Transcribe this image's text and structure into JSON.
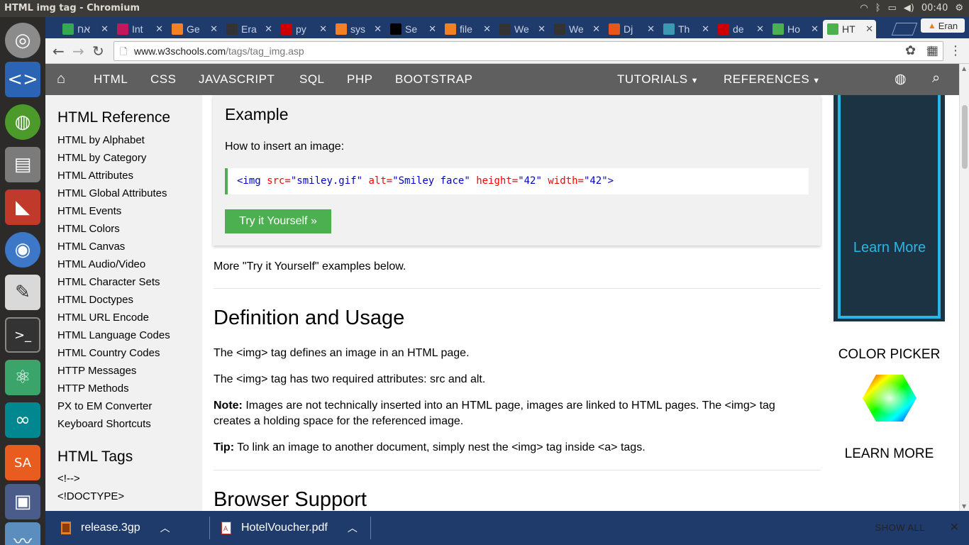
{
  "window": {
    "title": "HTML img tag - Chromium",
    "clock": "00:40"
  },
  "launcher": [
    "ubuntu-icon",
    "code-editor-icon",
    "network-globe-icon",
    "file-manager-icon",
    "red-app-icon",
    "chromium-icon",
    "text-editor-icon",
    "terminal-icon",
    "atom-icon",
    "arduino-icon",
    "sa-app-icon",
    "remote-desktop-icon",
    "system-monitor-icon"
  ],
  "tabs": [
    {
      "label": "אח",
      "icon": "google-drive-icon",
      "color": "#34a853"
    },
    {
      "label": "Int",
      "icon": "intellij-icon",
      "color": "#c2185b"
    },
    {
      "label": "Ge",
      "icon": "stackoverflow-icon",
      "color": "#f48024"
    },
    {
      "label": "Era",
      "icon": "github-icon",
      "color": "#333333"
    },
    {
      "label": "py",
      "icon": "pypi-icon",
      "color": "#cc0000"
    },
    {
      "label": "sys",
      "icon": "stackoverflow-icon",
      "color": "#f48024"
    },
    {
      "label": "Se",
      "icon": "ex-icon",
      "color": "#000000"
    },
    {
      "label": "file",
      "icon": "stackoverflow-icon",
      "color": "#f48024"
    },
    {
      "label": "We",
      "icon": "github-icon",
      "color": "#333333"
    },
    {
      "label": "We",
      "icon": "github-icon",
      "color": "#333333"
    },
    {
      "label": "Dj",
      "icon": "django-icon",
      "color": "#e8561a"
    },
    {
      "label": "Th",
      "icon": "p-icon",
      "color": "#3b9ab2"
    },
    {
      "label": "de",
      "icon": "pypi-icon",
      "color": "#cc0000"
    },
    {
      "label": "Ho",
      "icon": "z2-icon",
      "color": "#4caf50"
    },
    {
      "label": "HT",
      "icon": "w3schools-icon",
      "color": "#4caf50"
    }
  ],
  "profile": {
    "name": "Eran"
  },
  "omnibox": {
    "host": "www.w3schools.com",
    "path": "/tags/tag_img.asp"
  },
  "w3nav": {
    "links": [
      "HTML",
      "CSS",
      "JAVASCRIPT",
      "SQL",
      "PHP",
      "BOOTSTRAP"
    ],
    "tutorials": "TUTORIALS",
    "references": "REFERENCES"
  },
  "sidebar": {
    "heading": "HTML Reference",
    "links": [
      "HTML by Alphabet",
      "HTML by Category",
      "HTML Attributes",
      "HTML Global Attributes",
      "HTML Events",
      "HTML Colors",
      "HTML Canvas",
      "HTML Audio/Video",
      "HTML Character Sets",
      "HTML Doctypes",
      "HTML URL Encode",
      "HTML Language Codes",
      "HTML Country Codes",
      "HTTP Messages",
      "HTTP Methods",
      "PX to EM Converter",
      "Keyboard Shortcuts"
    ],
    "tags_heading": "HTML Tags",
    "tags": [
      "<!-->",
      "<!DOCTYPE>"
    ]
  },
  "example": {
    "heading": "Example",
    "intro": "How to insert an image:",
    "code": {
      "tag_open": "<img",
      "src_attr": " src=",
      "src_val": "\"smiley.gif\"",
      "alt_attr": " alt=",
      "alt_val": "\"Smiley face\"",
      "height_attr": " height=",
      "height_val": "\"42\"",
      "width_attr": " width=",
      "width_val": "\"42\"",
      "tag_close": ">"
    },
    "try_button": "Try it Yourself »"
  },
  "content": {
    "more_examples": "More \"Try it Yourself\" examples below.",
    "definition_heading": "Definition and Usage",
    "p1": "The <img> tag defines an image in an HTML page.",
    "p2": "The <img> tag has two required attributes: src and alt.",
    "note_label": "Note:",
    "note_line1": " Images are not technically inserted into an HTML page, images are linked to HTML pages. The <img> tag",
    "note_line2": "creates a holding space for the referenced image.",
    "tip_label": "Tip:",
    "tip_text": " To link an image to another document, simply nest the <img> tag inside <a> tags.",
    "browser_heading": "Browser Support"
  },
  "right": {
    "ad_learn_more": "Learn More",
    "color_picker": "COLOR PICKER",
    "learn_more": "LEARN MORE"
  },
  "downloads": {
    "items": [
      {
        "name": "release.3gp",
        "icon": "video-file-icon"
      },
      {
        "name": "HotelVoucher.pdf",
        "icon": "pdf-file-icon"
      }
    ],
    "show_all": "SHOW ALL"
  },
  "colors": {
    "w3_green": "#4caf50",
    "nav_gray": "#5f5f5f",
    "chrome_blue": "#1f3b6b",
    "ad_cyan": "#29b6e6"
  }
}
